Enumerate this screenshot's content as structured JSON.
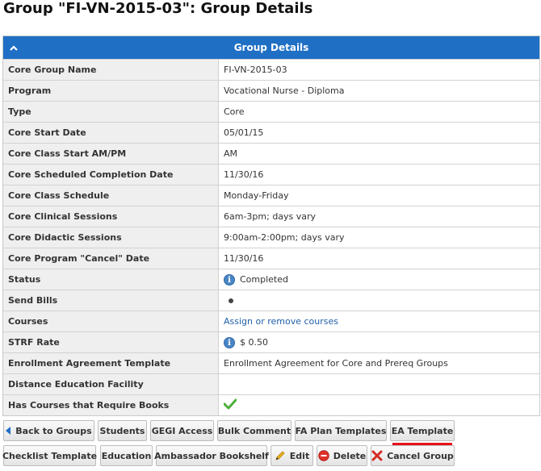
{
  "page": {
    "title": "Group \"FI-VN-2015-03\": Group Details"
  },
  "panel": {
    "header": "Group Details"
  },
  "details": [
    {
      "label": "Core Group Name",
      "value": "FI-VN-2015-03"
    },
    {
      "label": "Program",
      "value": "Vocational Nurse - Diploma"
    },
    {
      "label": "Type",
      "value": "Core"
    },
    {
      "label": "Core Start Date",
      "value": "05/01/15"
    },
    {
      "label": "Core Class Start AM/PM",
      "value": "AM"
    },
    {
      "label": "Core Scheduled Completion Date",
      "value": "11/30/16"
    },
    {
      "label": "Core Class Schedule",
      "value": "Monday-Friday"
    },
    {
      "label": "Core Clinical Sessions",
      "value": "6am-3pm; days vary"
    },
    {
      "label": "Core Didactic Sessions",
      "value": "9:00am-2:00pm; days vary"
    },
    {
      "label": "Core Program \"Cancel\" Date",
      "value": "11/30/16"
    },
    {
      "label": "Status",
      "value": "Completed",
      "icon": "info-icon"
    },
    {
      "label": "Send Bills",
      "value": "",
      "icon": "dot-icon"
    },
    {
      "label": "Courses",
      "value": "Assign or remove courses",
      "link": true
    },
    {
      "label": "STRF Rate",
      "value": "$ 0.50",
      "icon": "info-icon"
    },
    {
      "label": "Enrollment Agreement Template",
      "value": "Enrollment Agreement for Core and Prereq Groups"
    },
    {
      "label": "Distance Education Facility",
      "value": ""
    },
    {
      "label": "Has Courses that Require Books",
      "value": "",
      "icon": "checkmark-icon"
    }
  ],
  "buttons": {
    "back": "Back to Groups",
    "students": "Students",
    "gegi": "GEGI Access",
    "bulk_comment": "Bulk Comment",
    "fa_plan": "FA Plan Templates",
    "ea_template": "EA Template",
    "checklist": "Checklist Template",
    "education": "Education",
    "ambassador": "Ambassador Bookshelf",
    "edit": "Edit",
    "delete": "Delete",
    "cancel_group": "Cancel Group"
  },
  "colors": {
    "header_blue": "#1f6fc5",
    "link_blue": "#1f5fa8",
    "highlight_red": "#e8141c",
    "check_green": "#4caf3a"
  }
}
